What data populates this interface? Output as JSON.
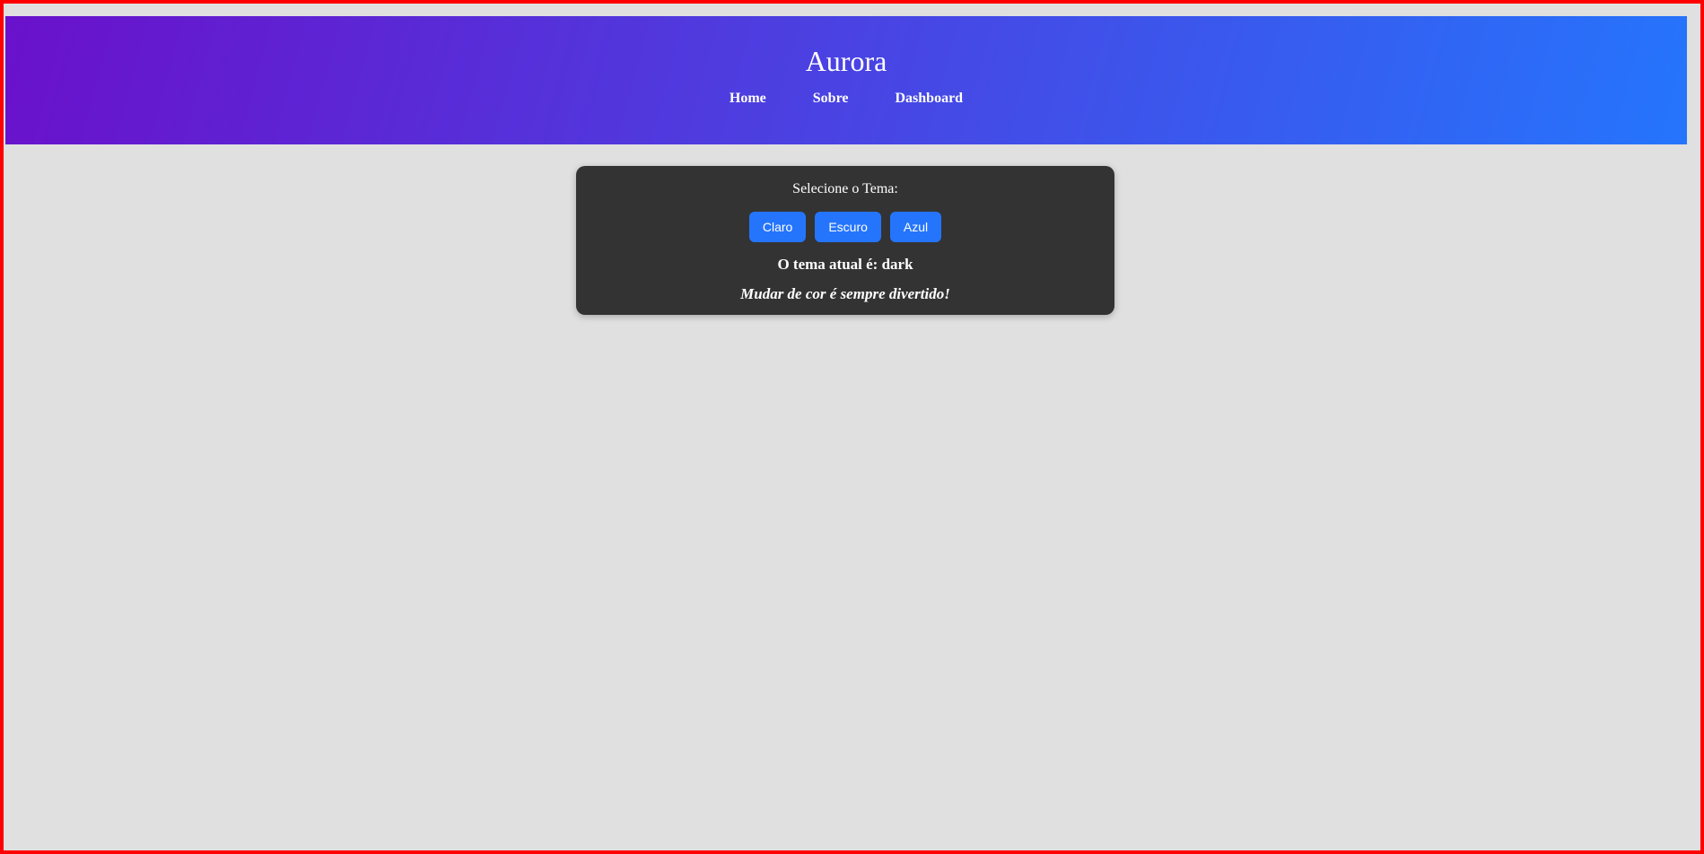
{
  "header": {
    "title": "Aurora",
    "nav": [
      {
        "label": "Home"
      },
      {
        "label": "Sobre"
      },
      {
        "label": "Dashboard"
      }
    ]
  },
  "theme_card": {
    "label": "Selecione o Tema:",
    "buttons": [
      {
        "label": "Claro"
      },
      {
        "label": "Escuro"
      },
      {
        "label": "Azul"
      }
    ],
    "current_theme": "O tema atual é: dark",
    "tagline": "Mudar de cor é sempre divertido!"
  },
  "colors": {
    "gradient_start": "#6a11cb",
    "gradient_end": "#2575fc",
    "card_background": "#333333",
    "button": "#2575fc",
    "page_background": "#e0e0e0",
    "frame_border": "#ff0000"
  }
}
